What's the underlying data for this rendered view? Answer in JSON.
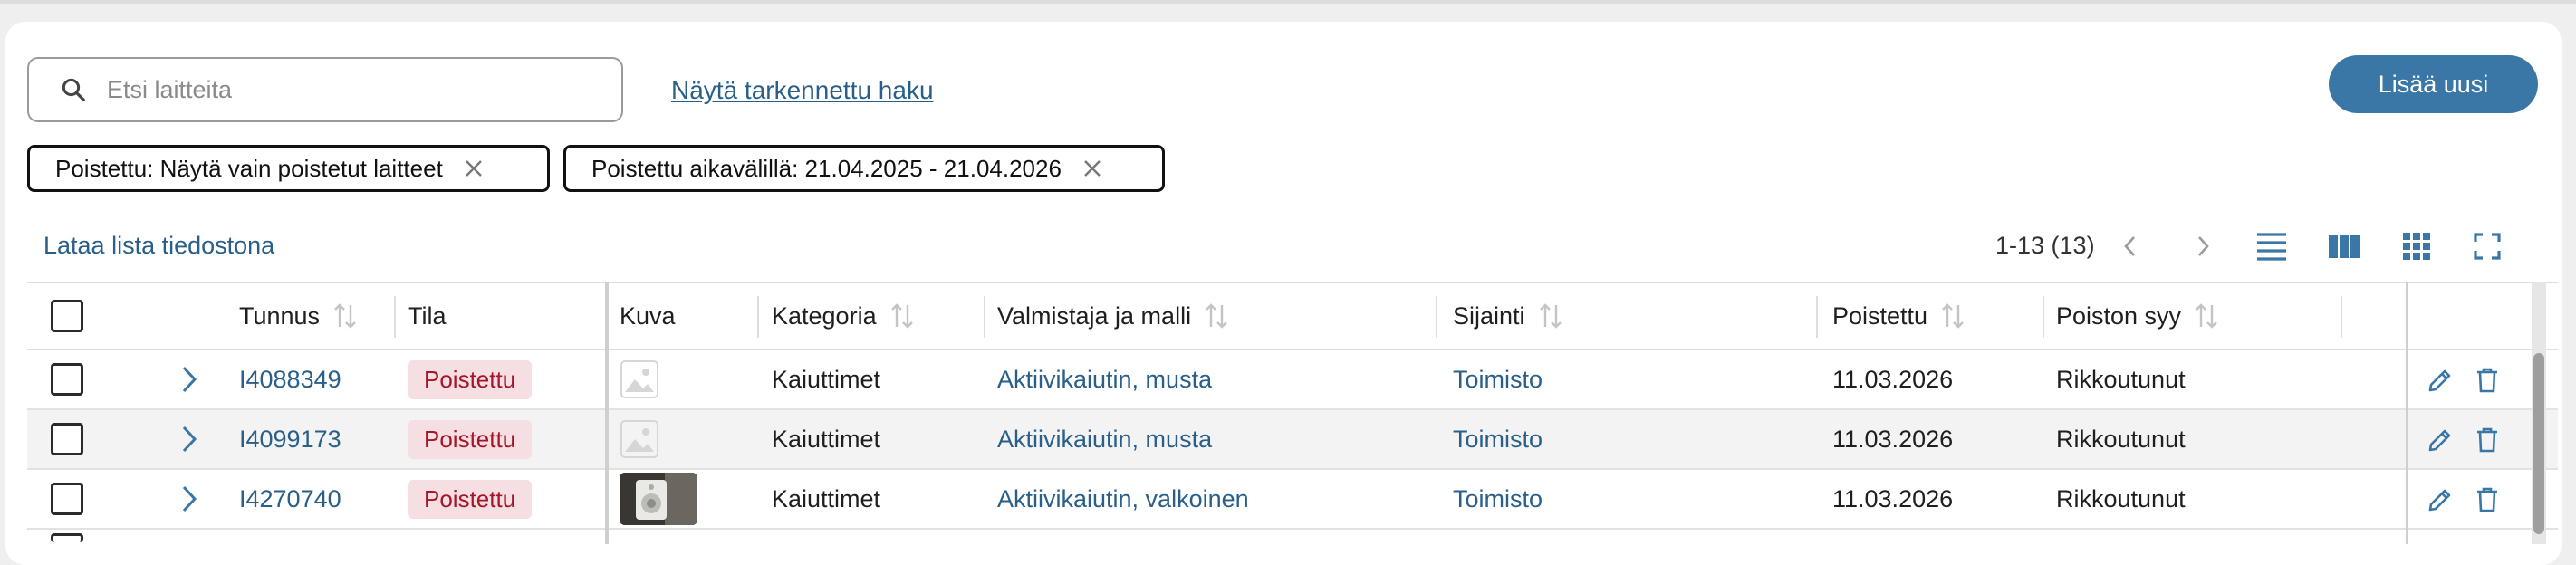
{
  "search": {
    "placeholder": "Etsi laitteita",
    "value": ""
  },
  "advanced_search_label": "Näytä tarkennettu haku",
  "add_new_label": "Lisää uusi",
  "filters": [
    {
      "label": "Poistettu: Näytä vain poistetut laitteet"
    },
    {
      "label": "Poistettu aikavälillä: 21.04.2025 - 21.04.2026"
    }
  ],
  "download_label": "Lataa lista tiedostona",
  "pagination": {
    "range_text": "1-13 (13)"
  },
  "columns": {
    "tunnus": "Tunnus",
    "tila": "Tila",
    "kuva": "Kuva",
    "kategoria": "Kategoria",
    "valmistaja": "Valmistaja ja malli",
    "sijainti": "Sijainti",
    "poistettu": "Poistettu",
    "syy": "Poiston syy"
  },
  "rows": [
    {
      "tunnus": "I4088349",
      "tila": "Poistettu",
      "image": "placeholder-icon",
      "kategoria": "Kaiuttimet",
      "valmistaja": "Aktiivikaiutin, musta",
      "sijainti": "Toimisto",
      "poistettu": "11.03.2026",
      "syy": "Rikkoutunut"
    },
    {
      "tunnus": "I4099173",
      "tila": "Poistettu",
      "image": "placeholder-icon",
      "kategoria": "Kaiuttimet",
      "valmistaja": "Aktiivikaiutin, musta",
      "sijainti": "Toimisto",
      "poistettu": "11.03.2026",
      "syy": "Rikkoutunut"
    },
    {
      "tunnus": "I4270740",
      "tila": "Poistettu",
      "image": "photo",
      "kategoria": "Kaiuttimet",
      "valmistaja": "Aktiivikaiutin, valkoinen",
      "sijainti": "Toimisto",
      "poistettu": "11.03.2026",
      "syy": "Rikkoutunut"
    }
  ],
  "colors": {
    "accent": "#3a77a6",
    "link": "#2a5f8a",
    "badge_bg": "#f6dfe2",
    "badge_text": "#a5162a"
  }
}
